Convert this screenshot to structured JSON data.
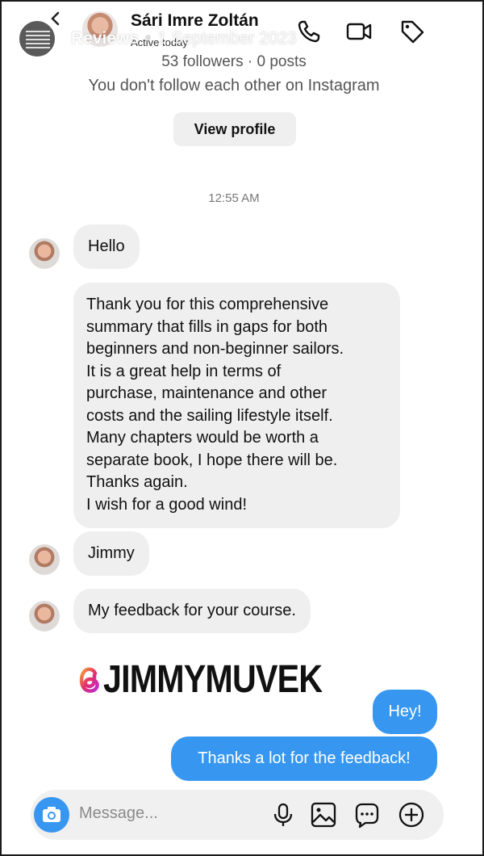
{
  "story": {
    "label": "Reviews",
    "date": "1 September 2023",
    "close_icon": "close-icon"
  },
  "header": {
    "name": "Sári Imre Zoltán",
    "status": "Active today",
    "icons": [
      "back-chevron-icon",
      "phone-icon",
      "video-icon",
      "tag-icon"
    ]
  },
  "profile": {
    "followers": "53 followers · 0 posts",
    "note": "You don't follow each other on Instagram",
    "view_profile_label": "View profile"
  },
  "thread": {
    "timestamp": "12:55 AM",
    "incoming": [
      {
        "text": "Hello"
      },
      {
        "lines": [
          "Thank you for this comprehensive",
          "summary that fills in gaps for both",
          "beginners and non-beginner sailors.",
          "It is a great help in terms of",
          "purchase, maintenance and other",
          "costs and the sailing lifestyle itself.",
          "Many chapters would be worth a",
          "separate book, I hope there will be.",
          "Thanks again.",
          "I wish for a good wind!"
        ]
      },
      {
        "text": "Jimmy"
      },
      {
        "text": "My feedback for your course."
      }
    ],
    "sticker": {
      "text": "JIMMYMUVEK",
      "icon": "threads-logo-icon"
    },
    "outgoing": [
      {
        "text": "Hey!"
      },
      {
        "text": "Thanks a lot for the feedback!"
      }
    ]
  },
  "composer": {
    "placeholder": "Message...",
    "icons": [
      "camera-icon",
      "microphone-icon",
      "gallery-icon",
      "sticker-icon",
      "plus-icon"
    ]
  },
  "colors": {
    "accent_blue": "#3797f0",
    "incoming_bubble": "#efefef",
    "background": "#ffffff"
  }
}
